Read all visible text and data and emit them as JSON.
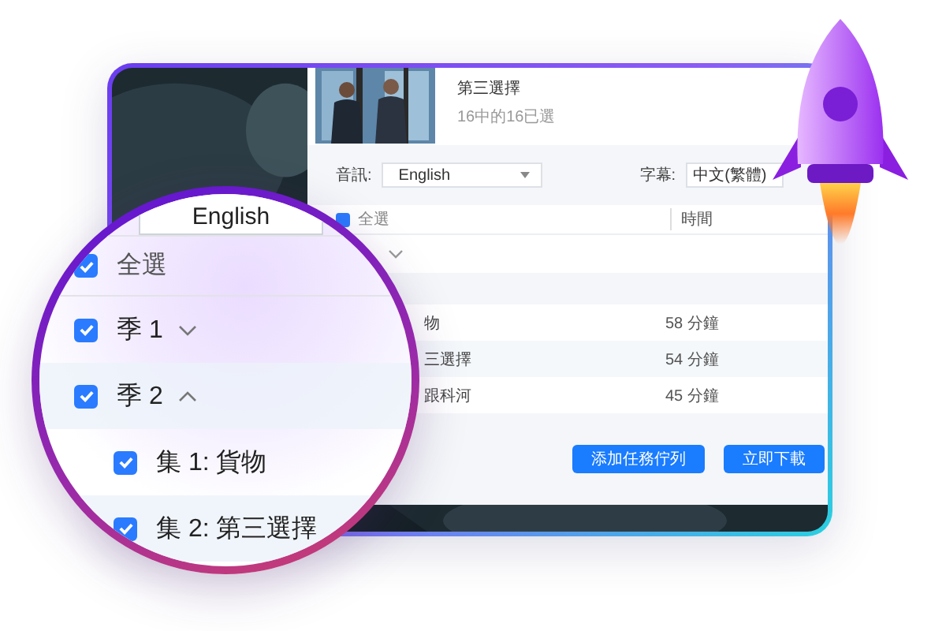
{
  "episode_header": {
    "title": "第三選擇",
    "subtitle": "16中的16已選"
  },
  "audio": {
    "label": "音訊:",
    "value": "English"
  },
  "subtitles": {
    "label": "字幕:",
    "value": "中文(繁體)"
  },
  "table": {
    "select_all": {
      "label": "全選",
      "checked": true
    },
    "time_header": "時間",
    "season_row": {
      "expanded": false
    },
    "rows": [
      {
        "title": "物",
        "duration": "58 分鐘"
      },
      {
        "title": "三選擇",
        "duration": "54 分鐘"
      },
      {
        "title": "跟科河",
        "duration": "45 分鐘"
      }
    ]
  },
  "buttons": [
    {
      "label": "添加任務佇列"
    },
    {
      "label": "立即下載"
    }
  ],
  "magnifier": {
    "audio_value": "English",
    "items": [
      {
        "kind": "select_all",
        "label": "全選",
        "checked": true
      },
      {
        "kind": "season",
        "label": "季 1",
        "checked": true,
        "expanded": false
      },
      {
        "kind": "season",
        "label": "季 2",
        "checked": true,
        "expanded": true
      },
      {
        "kind": "episode",
        "label": "集 1: 貨物",
        "checked": true
      },
      {
        "kind": "episode",
        "label": "集 2: 第三選擇",
        "checked": true
      }
    ]
  }
}
